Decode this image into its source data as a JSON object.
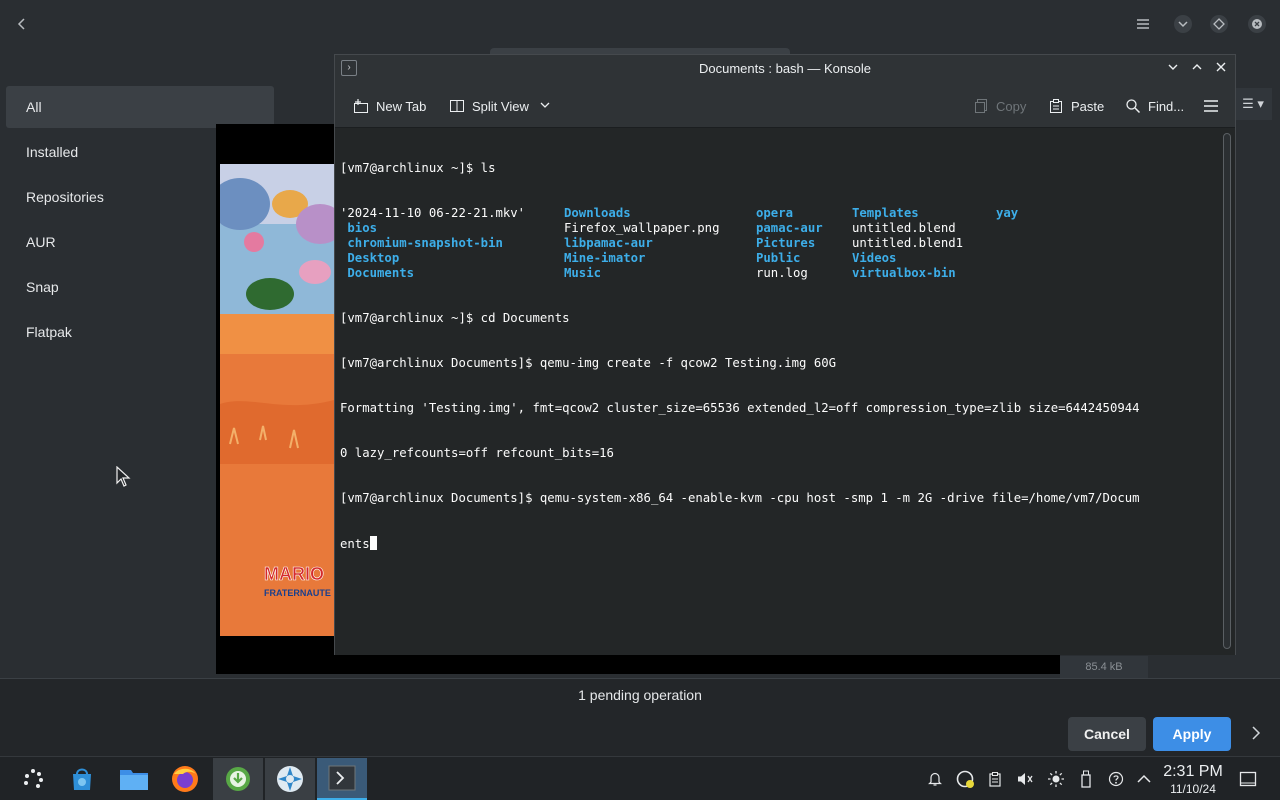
{
  "app": {
    "sidebar": {
      "items": [
        {
          "label": "All",
          "active": true
        },
        {
          "label": "Installed"
        },
        {
          "label": "Repositories"
        },
        {
          "label": "AUR"
        },
        {
          "label": "Snap"
        },
        {
          "label": "Flatpak"
        }
      ]
    },
    "preview": {
      "size_label": "85.4 kB",
      "art_text": [
        "MARIO",
        "FRATERNAUTE"
      ]
    },
    "bottom": {
      "pending_text": "1 pending operation",
      "cancel_label": "Cancel",
      "apply_label": "Apply"
    },
    "top_icons": [
      "back-arrow-icon",
      "hamburger-menu-icon",
      "chevron-down-icon",
      "diamond-icon",
      "close-circle-icon"
    ]
  },
  "konsole": {
    "title": "Documents : bash — Konsole",
    "toolbar": {
      "new_tab": "New Tab",
      "split_view": "Split View",
      "copy": "Copy",
      "paste": "Paste",
      "find": "Find..."
    },
    "terminal": {
      "line_prompt1": "[vm7@archlinux ~]$ ls",
      "ls_rows": [
        [
          {
            "t": "'2024-11-10 06-22-21.mkv'",
            "c": "file"
          },
          {
            "t": "Downloads",
            "c": "dir"
          },
          {
            "t": "opera",
            "c": "dir"
          },
          {
            "t": "Templates",
            "c": "dir"
          },
          {
            "t": "yay",
            "c": "dir"
          }
        ],
        [
          {
            "t": " bios",
            "c": "dir"
          },
          {
            "t": "Firefox_wallpaper.png",
            "c": "file"
          },
          {
            "t": "pamac-aur",
            "c": "dir"
          },
          {
            "t": "untitled.blend",
            "c": "file"
          },
          {
            "t": "",
            "c": "file"
          }
        ],
        [
          {
            "t": " chromium-snapshot-bin",
            "c": "dir"
          },
          {
            "t": "libpamac-aur",
            "c": "dir"
          },
          {
            "t": "Pictures",
            "c": "dir"
          },
          {
            "t": "untitled.blend1",
            "c": "file"
          },
          {
            "t": "",
            "c": "file"
          }
        ],
        [
          {
            "t": " Desktop",
            "c": "dir"
          },
          {
            "t": "Mine-imator",
            "c": "dir"
          },
          {
            "t": "Public",
            "c": "dir"
          },
          {
            "t": "Videos",
            "c": "dir"
          },
          {
            "t": "",
            "c": "file"
          }
        ],
        [
          {
            "t": " Documents",
            "c": "dir"
          },
          {
            "t": "Music",
            "c": "dir"
          },
          {
            "t": "run.log",
            "c": "file"
          },
          {
            "t": "virtualbox-bin",
            "c": "dir"
          },
          {
            "t": "",
            "c": "file"
          }
        ]
      ],
      "line_cd": "[vm7@archlinux ~]$ cd Documents",
      "line_create": "[vm7@archlinux Documents]$ qemu-img create -f qcow2 Testing.img 60G",
      "line_format1": "Formatting 'Testing.img', fmt=qcow2 cluster_size=65536 extended_l2=off compression_type=zlib size=6442450944",
      "line_format2": "0 lazy_refcounts=off refcount_bits=16",
      "line_system1": "[vm7@archlinux Documents]$ qemu-system-x86_64 -enable-kvm -cpu host -smp 1 -m 2G -drive file=/home/vm7/Docum",
      "line_system2": "ents"
    }
  },
  "taskbar": {
    "apps": [
      "app-launcher-icon",
      "discover-store-icon",
      "file-manager-icon",
      "firefox-icon",
      "package-manager-icon",
      "game-app-icon",
      "konsole-icon"
    ],
    "tray": [
      "notification-bell-icon",
      "update-status-icon",
      "clipboard-icon",
      "volume-muted-icon",
      "brightness-icon",
      "usb-device-icon",
      "help-icon",
      "expand-tray-icon",
      "show-desktop-icon"
    ],
    "clock_time": "2:31 PM",
    "clock_date": "11/10/24"
  },
  "colors": {
    "accent": "#3d8ee6",
    "terminal_dir": "#3daee9",
    "terminal_bg": "#232627"
  }
}
